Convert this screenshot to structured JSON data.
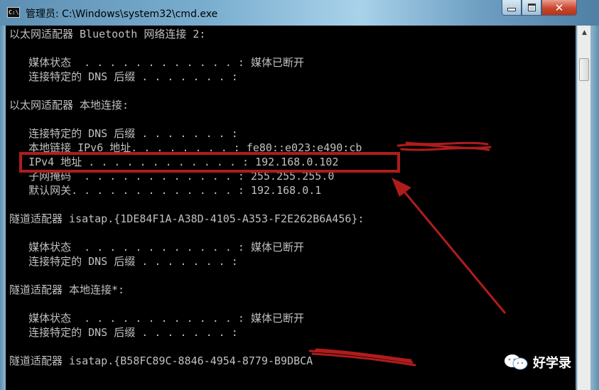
{
  "window": {
    "title": "管理员: C:\\Windows\\system32\\cmd.exe",
    "app_icon_text": "C:\\"
  },
  "console": {
    "lines": [
      "以太网适配器 Bluetooth 网络连接 2:",
      "",
      "   媒体状态  . . . . . . . . . . . . : 媒体已断开",
      "   连接特定的 DNS 后缀 . . . . . . . :",
      "",
      "以太网适配器 本地连接:",
      "",
      "   连接特定的 DNS 后缀 . . . . . . . :",
      "   本地链接 IPv6 地址. . . . . . . . : fe80::e023:e490:cb",
      "   IPv4 地址 . . . . . . . . . . . . : 192.168.0.102",
      "   子网掩码  . . . . . . . . . . . . : 255.255.255.0",
      "   默认网关. . . . . . . . . . . . . : 192.168.0.1",
      "",
      "隧道适配器 isatap.{1DE84F1A-A38D-4105-A353-F2E262B6A456}:",
      "",
      "   媒体状态  . . . . . . . . . . . . : 媒体已断开",
      "   连接特定的 DNS 后缀 . . . . . . . :",
      "",
      "隧道适配器 本地连接*:",
      "",
      "   媒体状态  . . . . . . . . . . . . : 媒体已断开",
      "   连接特定的 DNS 后缀 . . . . . . . :",
      "",
      "隧道适配器 isatap.{B58FC89C-8846-4954-8779-B9DBCA"
    ]
  },
  "annotation": {
    "highlight_color": "#b01c1c"
  },
  "watermark": {
    "text": "好学录",
    "icon": "wechat-icon"
  }
}
